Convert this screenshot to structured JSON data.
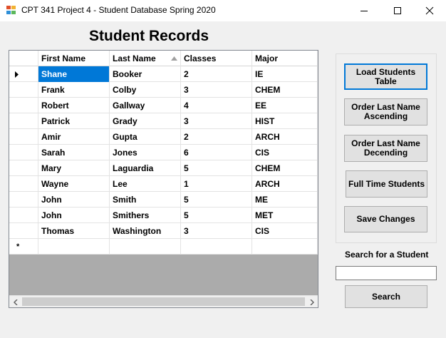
{
  "window": {
    "title": "CPT 341 Project 4 - Student Database Spring 2020"
  },
  "heading": "Student Records",
  "table": {
    "columns": [
      "First Name",
      "Last Name",
      "Classes",
      "Major"
    ],
    "sorted_column": "Last Name",
    "sort_direction": "ascending",
    "selected_row": 0,
    "rows": [
      [
        "Shane",
        "Booker",
        "2",
        "IE"
      ],
      [
        "Frank",
        "Colby",
        "3",
        "CHEM"
      ],
      [
        "Robert",
        "Gallway",
        "4",
        "EE"
      ],
      [
        "Patrick",
        "Grady",
        "3",
        "HIST"
      ],
      [
        "Amir",
        "Gupta",
        "2",
        "ARCH"
      ],
      [
        "Sarah",
        "Jones",
        "6",
        "CIS"
      ],
      [
        "Mary",
        "Laguardia",
        "5",
        "CHEM"
      ],
      [
        "Wayne",
        "Lee",
        "1",
        "ARCH"
      ],
      [
        "John",
        "Smith",
        "5",
        "ME"
      ],
      [
        "John",
        "Smithers",
        "5",
        "MET"
      ],
      [
        "Thomas",
        "Washington",
        "3",
        "CIS"
      ]
    ],
    "new_row_marker": "*"
  },
  "buttons": {
    "load": "Load Students Table",
    "asc": "Order Last Name Ascending",
    "desc": "Order Last Name Decending",
    "fulltime": "Full Time Students",
    "save": "Save Changes",
    "search": "Search"
  },
  "search": {
    "label": "Search for a Student",
    "value": "",
    "placeholder": ""
  },
  "icons": {
    "app": "app-icon",
    "minimize": "minimize-icon",
    "maximize": "maximize-icon",
    "close": "close-icon",
    "row_marker": "triangle-right-icon",
    "sort": "sort-up-icon",
    "scroll_left": "chevron-left-icon",
    "scroll_right": "chevron-right-icon"
  },
  "colors": {
    "selection": "#0078d7",
    "button_face": "#e1e1e1",
    "grid_background": "#ababab"
  }
}
